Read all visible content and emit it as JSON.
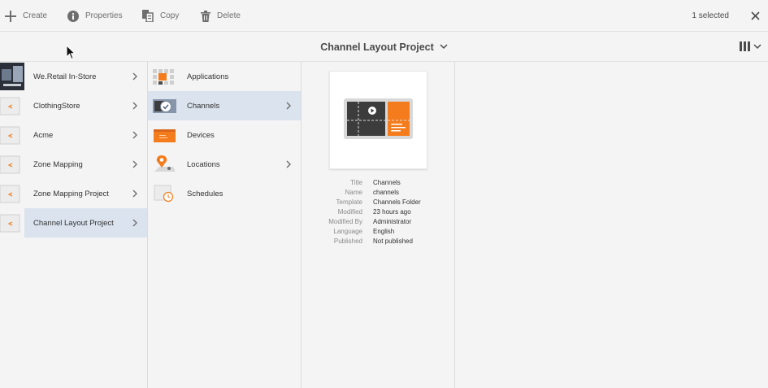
{
  "actionbar": {
    "create": "Create",
    "properties": "Properties",
    "copy": "Copy",
    "delete": "Delete",
    "selection": "1 selected"
  },
  "header": {
    "title": "Channel Layout Project"
  },
  "column1": {
    "items": [
      {
        "label": "We.Retail In-Store",
        "icon": "image-thumbnail"
      },
      {
        "label": "ClothingStore",
        "icon": "project-folder-icon"
      },
      {
        "label": "Acme",
        "icon": "project-folder-icon"
      },
      {
        "label": "Zone Mapping",
        "icon": "project-folder-icon"
      },
      {
        "label": "Zone Mapping Project",
        "icon": "project-folder-icon"
      },
      {
        "label": "Channel Layout Project",
        "icon": "project-folder-icon"
      }
    ]
  },
  "column2": {
    "items": [
      {
        "label": "Applications",
        "icon": "applications-icon"
      },
      {
        "label": "Channels",
        "icon": "channels-icon"
      },
      {
        "label": "Devices",
        "icon": "devices-icon"
      },
      {
        "label": "Locations",
        "icon": "locations-icon"
      },
      {
        "label": "Schedules",
        "icon": "schedules-icon"
      }
    ]
  },
  "details": {
    "rows": [
      {
        "key": "Title",
        "value": "Channels"
      },
      {
        "key": "Name",
        "value": "channels"
      },
      {
        "key": "Template",
        "value": "Channels Folder"
      },
      {
        "key": "Modified",
        "value": "23 hours ago"
      },
      {
        "key": "Modified By",
        "value": "Administrator"
      },
      {
        "key": "Language",
        "value": "English"
      },
      {
        "key": "Published",
        "value": "Not published"
      }
    ]
  },
  "colors": {
    "accent_orange": "#f47c1c",
    "selected_bg": "#dae3ee",
    "channel_dark": "#3c3c3c"
  }
}
